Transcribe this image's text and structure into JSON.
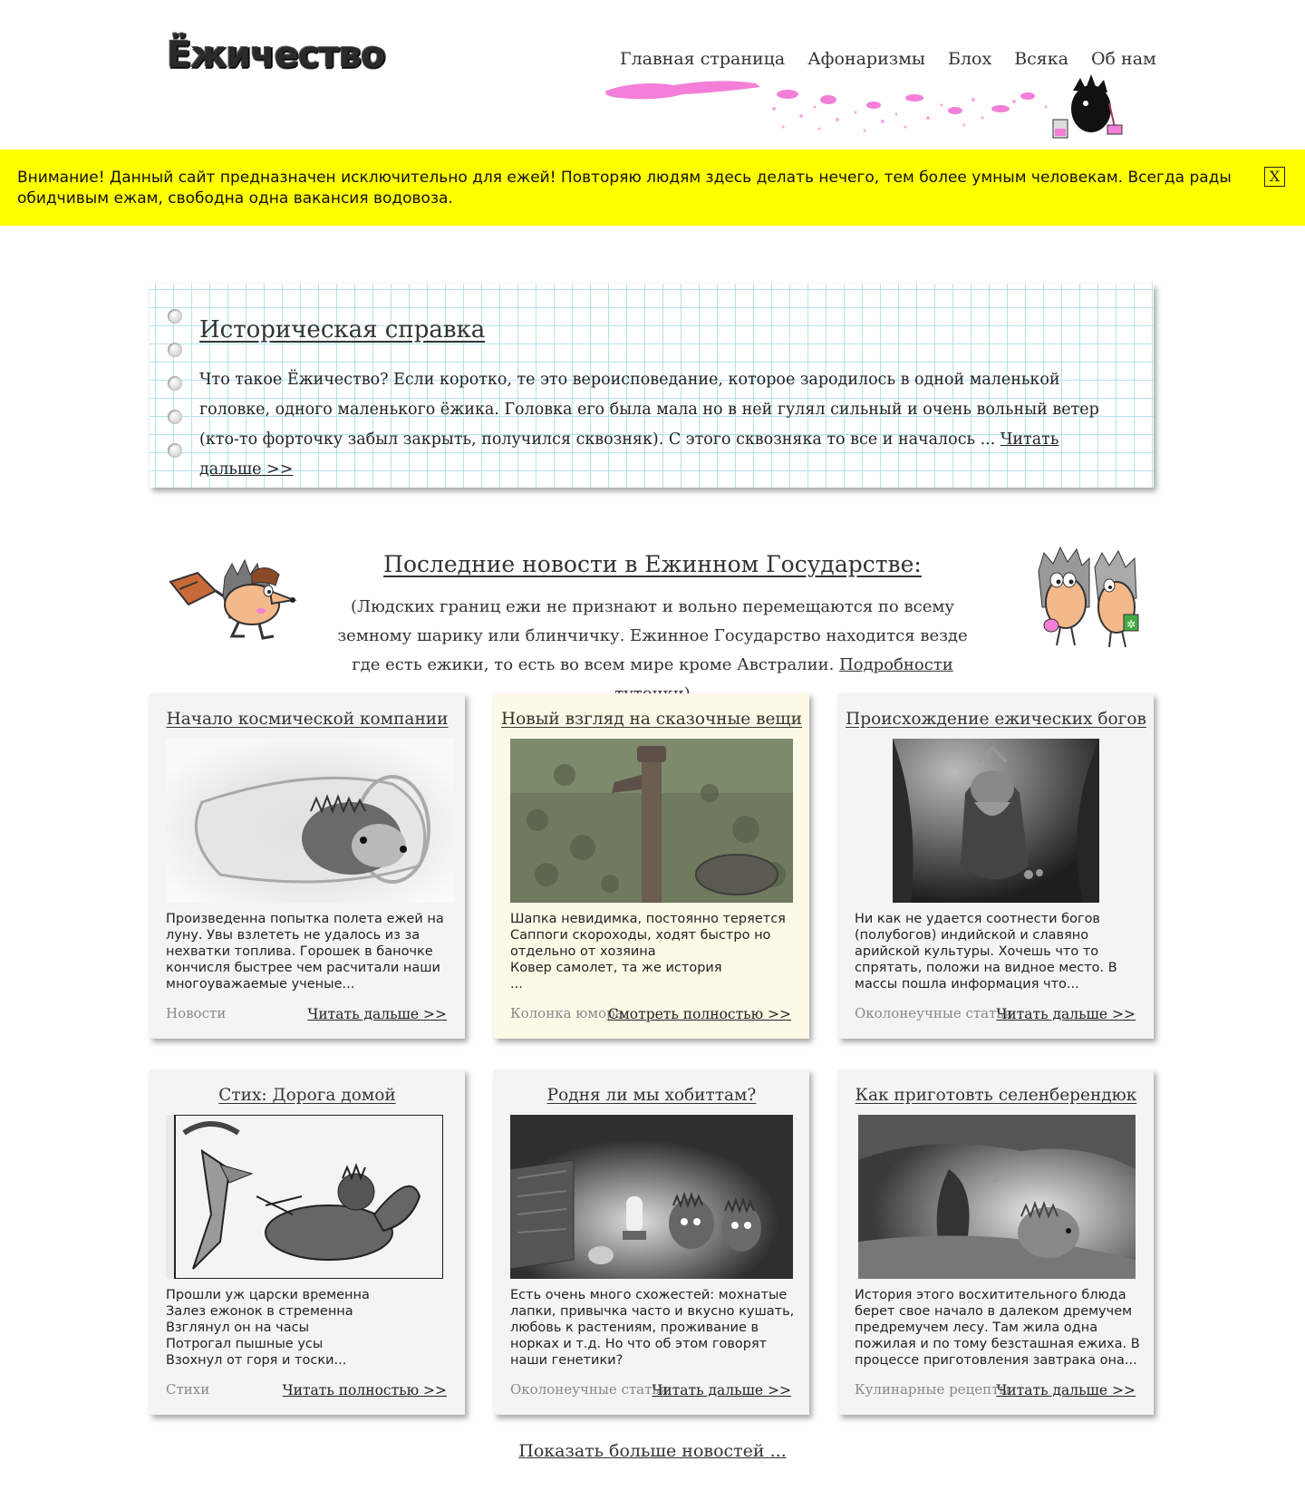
{
  "header": {
    "logo": "Ёжичество",
    "nav": [
      "Главная страница",
      "Афонаризмы",
      "Блох",
      "Всяка",
      "Об нам"
    ]
  },
  "alert": {
    "text": "Внимание! Данный сайт предназначен исключительно для ежей! Повторяю людям здесь делать нечего, тем более умным человекам. Всегда рады обидчивым ежам, свободна одна вакансия водовоза.",
    "close": "X",
    "color": "#ffff00"
  },
  "history": {
    "title": "Историческая справка",
    "text": "Что такое Ёжичество? Если коротко, те это вероисповедание, которое зародилось в одной маленькой головке, одного маленького ёжика. Головка его была мала но в ней гулял сильный и очень вольный ветер (кто-то форточку забыл закрыть, получился сквозняк). С этого сквозняка то все и началось ... ",
    "link": "Читать дальше >>"
  },
  "news": {
    "title": "Последние новости в Ежинном Государстве:",
    "subtitle": "(Людских границ ежи не признают и вольно перемещаются по всему земному шарику или блинчичку. Ежинное Государство находится везде где есть ежики, то есть во всем мире кроме Австралии. ",
    "subtitle_link": "Подробности туточки",
    "subtitle_end": ")",
    "cards": [
      {
        "title": "Начало космической компании",
        "text": "Произведенна попытка полета ежей на луну. Увы взлететь не удалось из за нехватки топлива. Горошек в баночке кончисля быстрее чем расчитали наши многоуважаемые ученые...",
        "category": "Новости",
        "more": "Читать дальше >>"
      },
      {
        "title": "Новый взгляд на сказочные вещи",
        "text": " Шапка невидимка, постоянно теряется\n Саппоги скороходы, ходят быстро но отдельно от хозяина\n Ковер самолет, та же история\n ...",
        "category": "Колонка юмора",
        "more": "Смотреть полностью >>"
      },
      {
        "title": "Происхождение ежических богов",
        "text": "Ни как не удается соотнести богов (полубогов) индийской и славяно арийской культуры.  Хочешь что то спрятать, положи на видное место. В массы пошла информация что...",
        "category": "Околонеучные статьи",
        "more": "Читать дальше >>"
      },
      {
        "title": "Стих: Дорога домой",
        "text": "Прошли уж царски временна\nЗалез ежонок в стременна\nВзглянул он на часы\nПотрогал пышные усы\nВзохнул от горя и тоски...",
        "category": "Стихи",
        "more": "Читать полностью >>"
      },
      {
        "title": "Родня ли мы хобиттам?",
        "text": "Есть очень много схожестей: мохнатые лапки, привычка часто и вкусно кушать, любовь к растениям, проживание в норках и т.д. Но что об этом говорят наши генетики?",
        "category": "Околонеучные статьи",
        "more": "Читать дальше >>"
      },
      {
        "title": "Как приготовть селенберендюк",
        "text": "История этого восхитительного блюда берет свое начало в далеком дремучем предремучем лесу. Там жила одна пожилая и по тому безсташная ежиха. В процессе приготовления завтрака она...",
        "category": "Кулинарные рецепты",
        "more": "Читать дальше >>"
      }
    ],
    "show_more": "Показать больше новостей ..."
  }
}
